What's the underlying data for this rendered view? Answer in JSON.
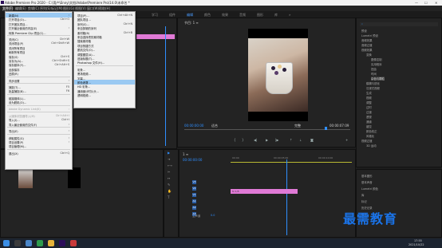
{
  "window": {
    "title": "Adobe Premiere Pro 2020 - C:\\用户\\Enny\\文档\\Adobe\\Premiere Pro\\14.0\\未命名 *",
    "minimize": "—",
    "maximize": "☐",
    "close": "✕"
  },
  "menubar": [
    "文件(F)",
    "编辑(E)",
    "剪辑(C)",
    "序列(S)",
    "标记(M)",
    "图形(G)",
    "视图(V)",
    "窗口(W)",
    "帮助(H)"
  ],
  "workspaces": [
    "学习",
    "组件",
    "编辑",
    "颜色",
    "效果",
    "音频",
    "图形",
    "库",
    "»"
  ],
  "file_menu": [
    {
      "label": "新建(N)",
      "shortcut": "",
      "highlight": true,
      "arrow": true
    },
    {
      "label": "打开项目(O)...",
      "shortcut": "Ctrl+O"
    },
    {
      "label": "打开团队项目...",
      "shortcut": ""
    },
    {
      "label": "打开最近使用的内容(E)",
      "shortcut": "",
      "arrow": true
    },
    {
      "label": "转换 Premiere Clip 项目(C)...",
      "shortcut": ""
    },
    {
      "sep": true
    },
    {
      "label": "关闭(C)",
      "shortcut": "Ctrl+W"
    },
    {
      "label": "关闭项目(P)",
      "shortcut": "Ctrl+Shift+W"
    },
    {
      "label": "关闭所有项目",
      "shortcut": ""
    },
    {
      "label": "刷新所有项目",
      "shortcut": ""
    },
    {
      "label": "保存(S)",
      "shortcut": "Ctrl+S"
    },
    {
      "label": "另存为(A)...",
      "shortcut": "Ctrl+Shift+S"
    },
    {
      "label": "保存副本(Y)...",
      "shortcut": "Ctrl+Alt+S"
    },
    {
      "label": "全部保存",
      "shortcut": ""
    },
    {
      "label": "还原(R)",
      "shortcut": ""
    },
    {
      "sep": true
    },
    {
      "label": "同步设置",
      "shortcut": "",
      "arrow": true
    },
    {
      "sep": true
    },
    {
      "label": "捕捉(T)...",
      "shortcut": "F5"
    },
    {
      "label": "批量捕捉(B)...",
      "shortcut": "F6"
    },
    {
      "sep": true
    },
    {
      "label": "链接媒体(L)...",
      "shortcut": ""
    },
    {
      "label": "设为脱机(O)...",
      "shortcut": ""
    },
    {
      "sep": true
    },
    {
      "label": "Adobe Dynamic Link(K)",
      "shortcut": "",
      "arrow": true,
      "disabled": true
    },
    {
      "sep": true
    },
    {
      "label": "从媒体浏览器导入(M)",
      "shortcut": "Ctrl+Alt+I",
      "disabled": true
    },
    {
      "label": "导入(I)...",
      "shortcut": "Ctrl+I"
    },
    {
      "label": "导入最近使用的文件(F)",
      "shortcut": "",
      "arrow": true
    },
    {
      "sep": true
    },
    {
      "label": "导出(E)",
      "shortcut": "",
      "arrow": true
    },
    {
      "sep": true
    },
    {
      "label": "获取属性(G)",
      "shortcut": "",
      "arrow": true
    },
    {
      "label": "项目设置(P)",
      "shortcut": "",
      "arrow": true
    },
    {
      "label": "项目管理(M)...",
      "shortcut": ""
    },
    {
      "sep": true
    },
    {
      "label": "退出(X)",
      "shortcut": "Ctrl+Q"
    }
  ],
  "new_submenu": [
    {
      "label": "项目(P)...",
      "shortcut": "Ctrl+Alt+N"
    },
    {
      "label": "团队项目...",
      "shortcut": ""
    },
    {
      "label": "序列(S)...",
      "shortcut": "Ctrl+N"
    },
    {
      "label": "来自剪辑的序列",
      "shortcut": ""
    },
    {
      "label": "素材箱(B)",
      "shortcut": "Ctrl+B"
    },
    {
      "label": "来自选择项的素材箱",
      "shortcut": ""
    },
    {
      "label": "搜索素材箱",
      "shortcut": ""
    },
    {
      "label": "项目快捷方式",
      "shortcut": ""
    },
    {
      "label": "脱机文件(O)...",
      "shortcut": ""
    },
    {
      "label": "调整图层(A)...",
      "shortcut": ""
    },
    {
      "label": "旧版标题(T)...",
      "shortcut": ""
    },
    {
      "label": "Photoshop 文件(H)...",
      "shortcut": ""
    },
    {
      "sep": true
    },
    {
      "label": "彩条...",
      "shortcut": ""
    },
    {
      "label": "黑场视频...",
      "shortcut": ""
    },
    {
      "label": "字幕...",
      "shortcut": ""
    },
    {
      "label": "颜色遮罩...",
      "shortcut": "",
      "highlight": true
    },
    {
      "label": "HD 彩条...",
      "shortcut": ""
    },
    {
      "label": "通用倒计时片头...",
      "shortcut": ""
    },
    {
      "label": "透明视频...",
      "shortcut": ""
    }
  ],
  "program_monitor": {
    "title": "节目: 1 ≡",
    "timecode_left": "00:00:00:00",
    "fit": "适合",
    "ratio": "完整",
    "timecode_right": "00:00:07:09"
  },
  "timeline": {
    "tab": "1 ≡",
    "timecode": "00:00:00:00",
    "ruler": [
      "00:00",
      "00:00:05:00",
      "00:00:10:00"
    ],
    "tracks": [
      "V3",
      "V2",
      "V1",
      "A1",
      "A2",
      "A3"
    ],
    "master": "主声道",
    "master_value": "0.0",
    "clip_label": "fx 1/5"
  },
  "effects_tree": [
    "预设",
    "Lumetri 预设",
    "音频效果",
    "音频过渡",
    "视频效果",
    "变换",
    "图像控制",
    "实用程序",
    "扭曲",
    "时间",
    "杂色与颗粒",
    "模糊与锐化",
    "沉浸式视频",
    "生成",
    "视频",
    "调整",
    "过时",
    "过渡",
    "透视",
    "通道",
    "键控",
    "颜色校正",
    "风格化",
    "视频过渡",
    "3D 运动"
  ],
  "right_bottom": [
    "基本图形",
    "基本声音",
    "Lumetri 颜色",
    "库",
    "标记",
    "历史记录",
    "信息"
  ],
  "watermark": "最需教育",
  "taskbar": {
    "time": "17:55",
    "date": "2021/10/22"
  }
}
